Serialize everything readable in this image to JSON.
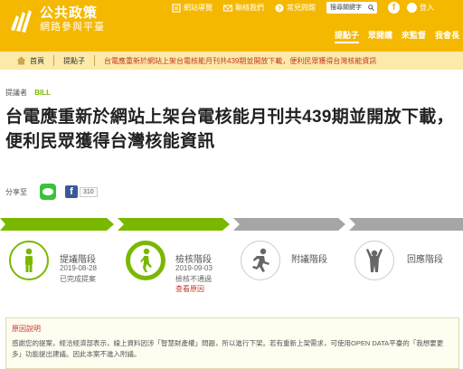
{
  "header": {
    "title": "公共政策",
    "subtitle": "網路參與平臺",
    "util": {
      "sitemap": "網站導覽",
      "contact": "聯絡我們",
      "faq": "常見問題",
      "search_placeholder": "搜尋關鍵字",
      "fb": "f",
      "login": "登入"
    },
    "nav": [
      "提點子",
      "眾開講",
      "來監督",
      "我會長"
    ],
    "brand_color": "#f5b800"
  },
  "breadcrumb": {
    "home": "首頁",
    "section": "提點子",
    "current": "台電應重新於網站上架台電核能月刊共439期並開放下載，便利民眾獲得台灣核能資訊"
  },
  "proposal": {
    "proposer_label": "提議者",
    "proposer_name": "BILL",
    "title": "台電應重新於網站上架台電核能月刊共439期並開放下載，便利民眾獲得台灣核能資訊"
  },
  "share": {
    "label": "分享至",
    "fb_letter": "f",
    "fb_count": "310"
  },
  "stages": [
    {
      "name": "提議階段",
      "date": "2019-08-28",
      "note": "已完成提案",
      "link": "",
      "status": "done",
      "icon": "person-standing-icon"
    },
    {
      "name": "檢核階段",
      "date": "2019-09-03",
      "note": "檢核不通過",
      "link": "查看原因",
      "status": "current",
      "icon": "person-walking-icon"
    },
    {
      "name": "附議階段",
      "date": "",
      "note": "",
      "link": "",
      "status": "inactive",
      "icon": "person-running-icon"
    },
    {
      "name": "回應階段",
      "date": "",
      "note": "",
      "link": "",
      "status": "inactive",
      "icon": "person-cheering-icon"
    }
  ],
  "reason": {
    "title": "原因說明",
    "body": "感謝您的提案，經洽經濟部表示，線上資料因涉「智慧財產權」問題，所以進行下架。若有重新上架需求，可使用OPEN DATA平臺的「我想要更多」功能提出建議。因此本案不進入附議。"
  },
  "colors": {
    "green": "#7ab800",
    "grey": "#a6a6a6",
    "accent_red": "#c0392b"
  }
}
